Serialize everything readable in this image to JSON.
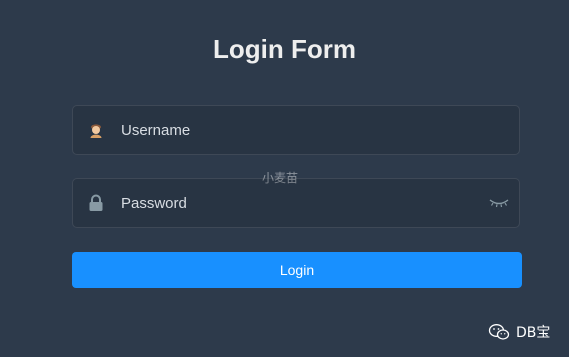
{
  "form": {
    "title": "Login Form",
    "username": {
      "placeholder": "Username",
      "icon": "user-avatar-icon"
    },
    "password": {
      "placeholder": "Password",
      "icon": "lock-icon",
      "toggle_icon": "eye-closed-icon"
    },
    "login_label": "Login"
  },
  "watermark": {
    "center_text": "小麦苗",
    "brand_icon": "wechat-icon",
    "brand_text": "DB宝"
  },
  "colors": {
    "background": "#2d3a4b",
    "button": "#1890ff",
    "title": "#eeeeee"
  }
}
